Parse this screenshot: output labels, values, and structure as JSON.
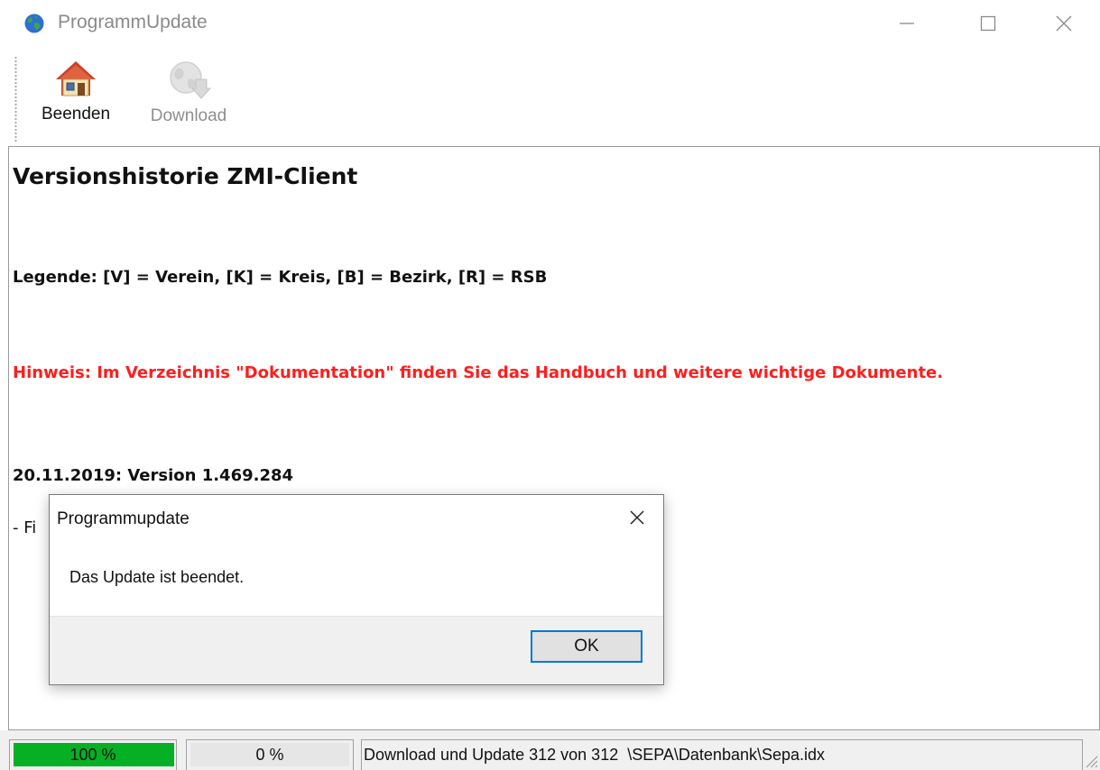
{
  "window": {
    "title": "ProgrammUpdate",
    "icon": "globe-icon",
    "controls": [
      "minimize-icon",
      "maximize-icon",
      "close-icon"
    ]
  },
  "toolbar": {
    "buttons": [
      {
        "label": "Beenden",
        "icon": "house-icon",
        "enabled": true
      },
      {
        "label": "Download",
        "icon": "globe-download-icon",
        "enabled": false
      }
    ]
  },
  "content": {
    "heading": "Versionshistorie ZMI-Client",
    "legend": "Legende:  [V] = Verein,  [K] = Kreis,  [B] = Bezirk,  [R] = RSB",
    "hint": "Hinweis: Im Verzeichnis \"Dokumentation\" finden Sie das Handbuch und weitere wichtige Dokumente.",
    "version_line": "20.11.2019: Version 1.469.284",
    "partial_line": "- Fi",
    "hint_color": "#ff1e1e"
  },
  "dialog": {
    "title": "Programmupdate",
    "message": "Das Update ist beendet.",
    "ok_label": "OK",
    "accent": "#0078d7"
  },
  "statusbar": {
    "progress_total_text": "100 %",
    "progress_total_percent": 100,
    "progress_file_text": "0 %",
    "progress_file_percent": 0,
    "status_text": "Download und Update 312 von 312  \\SEPA\\Datenbank\\Sepa.idx",
    "progress_color": "#06b025"
  }
}
